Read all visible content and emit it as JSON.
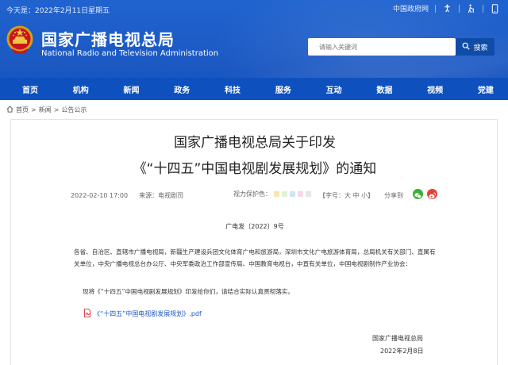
{
  "topbar": {
    "date": "今天是：2022年2月11日星期五",
    "gov_link": "中国政府网"
  },
  "site": {
    "title_cn": "国家广播电视总局",
    "title_en": "National Radio and Television Administration"
  },
  "search": {
    "placeholder": "请输入关键词",
    "button": "搜索"
  },
  "nav": {
    "items": [
      "首页",
      "机构",
      "新闻",
      "政务",
      "科技",
      "服务",
      "互动",
      "数据",
      "视频",
      "党建"
    ]
  },
  "breadcrumb": {
    "home": "首页",
    "news": "新闻",
    "current": "公告公示",
    "sep": ">"
  },
  "article": {
    "title_line1": "国家广播电视总局关于印发",
    "title_line2": "《“十四五”中国电视剧发展规划》的通知",
    "date": "2022-02-10 17:00",
    "source": "来源：电视剧司",
    "eye_label": "视力保护色：",
    "font_size": "【字号：大 中 小】",
    "share_label": "分享到",
    "doc_no": "广电发〔2022〕9号",
    "para1": "各省、自治区、直辖市广播电视局，新疆生产建设兵团文化体育广电和旅游局，深圳市文化广电旅游体育局，总局机关有关部门、直属有关单位，中央广播电视总台办公厅、中央军委政治工作部宣传局、中国教育电视台，中直有关单位，中国电视剧制作产业协会：",
    "para2": "现将《“十四五”中国电视剧发展规划》印发给你们，请结合实际认真贯彻落实。",
    "attachment": "《“十四五”中国电视剧发展规划》.pdf",
    "sign_org": "国家广播电视总局",
    "sign_date": "2022年2月8日"
  },
  "colors": {
    "header_blue": "#1a5cc8",
    "nav_blue": "#0e51be",
    "eye_swatches": [
      "#f5e6b3",
      "#e3f0d4",
      "#cfe6f5",
      "#f3d9e4",
      "#e6e6e6"
    ],
    "wechat_green": "#3cb035",
    "weibo_red": "#e5403a"
  },
  "icons": [
    "accessibility-icon",
    "elder-mode-icon",
    "mobile-icon",
    "national-emblem",
    "search-icon",
    "home-icon",
    "pdf-icon",
    "wechat-icon",
    "weibo-icon"
  ]
}
